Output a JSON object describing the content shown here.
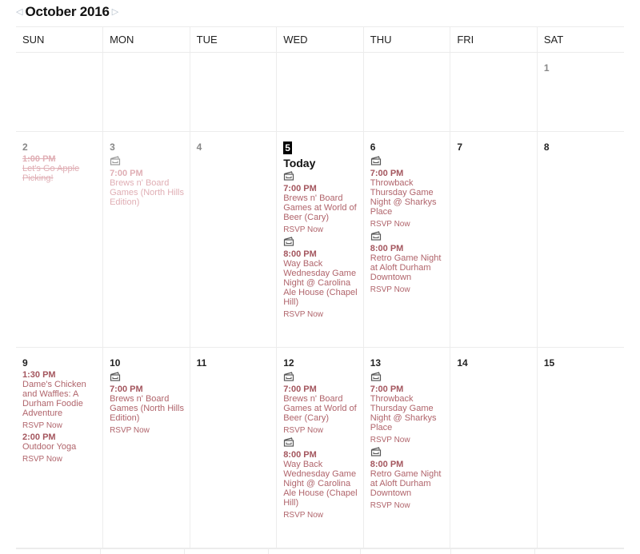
{
  "header": {
    "title": "October 2016",
    "prev_icon": "triangle-left-icon",
    "next_icon": "triangle-right-icon"
  },
  "weekdays": [
    "SUN",
    "MON",
    "TUE",
    "WED",
    "THU",
    "FRI",
    "SAT"
  ],
  "today_label": "Today",
  "rsvp_label": "RSVP Now",
  "colors": {
    "accent": "#a4565e",
    "past": "#e0afb5",
    "grid": "#ececec"
  },
  "weeks": [
    {
      "days": [
        {
          "num": "",
          "events": []
        },
        {
          "num": "",
          "events": []
        },
        {
          "num": "",
          "events": []
        },
        {
          "num": "",
          "events": []
        },
        {
          "num": "",
          "events": []
        },
        {
          "num": "",
          "events": []
        },
        {
          "num": "1",
          "past": true,
          "events": []
        }
      ]
    },
    {
      "days": [
        {
          "num": "2",
          "past": true,
          "events": [
            {
              "time": "1:00 PM",
              "title": "Let's Go Apple Picking!",
              "icon": false,
              "rsvp": false,
              "strike": true
            }
          ]
        },
        {
          "num": "3",
          "past": true,
          "events": [
            {
              "time": "7:00 PM",
              "title": "Brews n' Board Games (North Hills Edition)",
              "icon": true,
              "rsvp": false
            }
          ]
        },
        {
          "num": "4",
          "past": true,
          "events": []
        },
        {
          "num": "5",
          "today": true,
          "events": [
            {
              "time": "7:00 PM",
              "title": "Brews n' Board Games at World of Beer (Cary)",
              "icon": true,
              "rsvp": true
            },
            {
              "time": "8:00 PM",
              "title": "Way Back Wednesday Game Night @ Carolina Ale House (Chapel Hill)",
              "icon": true,
              "rsvp": true
            }
          ]
        },
        {
          "num": "6",
          "events": [
            {
              "time": "7:00 PM",
              "title": "Throwback Thursday Game Night @ Sharkys Place",
              "icon": true,
              "rsvp": true
            },
            {
              "time": "8:00 PM",
              "title": "Retro Game Night at Aloft Durham Downtown",
              "icon": true,
              "rsvp": true
            }
          ]
        },
        {
          "num": "7",
          "events": []
        },
        {
          "num": "8",
          "events": []
        }
      ]
    },
    {
      "days": [
        {
          "num": "9",
          "events": [
            {
              "time": "1:30 PM",
              "title": "Dame's Chicken and Waffles: A Durham Foodie Adventure",
              "icon": false,
              "rsvp": true
            },
            {
              "time": "2:00 PM",
              "title": "Outdoor Yoga",
              "icon": false,
              "rsvp": true
            }
          ]
        },
        {
          "num": "10",
          "events": [
            {
              "time": "7:00 PM",
              "title": "Brews n' Board Games (North Hills Edition)",
              "icon": true,
              "rsvp": true
            }
          ]
        },
        {
          "num": "11",
          "events": []
        },
        {
          "num": "12",
          "events": [
            {
              "time": "7:00 PM",
              "title": "Brews n' Board Games at World of Beer (Cary)",
              "icon": true,
              "rsvp": true
            },
            {
              "time": "8:00 PM",
              "title": "Way Back Wednesday Game Night @ Carolina Ale House (Chapel Hill)",
              "icon": true,
              "rsvp": true
            }
          ]
        },
        {
          "num": "13",
          "events": [
            {
              "time": "7:00 PM",
              "title": "Throwback Thursday Game Night @ Sharkys Place",
              "icon": true,
              "rsvp": true
            },
            {
              "time": "8:00 PM",
              "title": "Retro Game Night at Aloft Durham Downtown",
              "icon": true,
              "rsvp": true
            }
          ]
        },
        {
          "num": "14",
          "events": []
        },
        {
          "num": "15",
          "events": []
        }
      ]
    }
  ]
}
